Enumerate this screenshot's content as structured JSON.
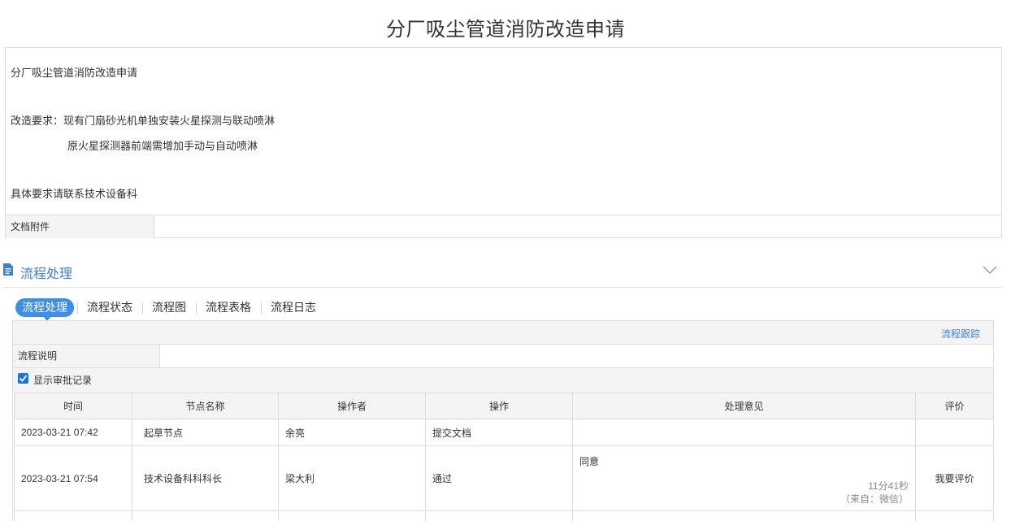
{
  "page": {
    "title": "分厂吸尘管道消防改造申请"
  },
  "document": {
    "lines": [
      "分厂吸尘管道消防改造申请",
      "改造要求：现有门扇砂光机单独安装火星探测与联动喷淋",
      "原火星探测器前端需增加手动与自动喷淋",
      "具体要求请联系技术设备科"
    ],
    "attachment_label": "文档附件"
  },
  "section": {
    "title": "流程处理",
    "icons": [
      "document-icon",
      "chevron-down-icon"
    ]
  },
  "tabs": [
    "流程处理",
    "流程状态",
    "流程图",
    "流程表格",
    "流程日志"
  ],
  "panel": {
    "trace_link": "流程跟踪",
    "desc_label": "流程说明",
    "desc_value": "",
    "show_records_label": "显示审批记录",
    "show_records_checked": true
  },
  "records": {
    "headers": [
      "时间",
      "节点名称",
      "操作者",
      "操作",
      "处理意见",
      "评价"
    ],
    "rows": [
      {
        "time": "2023-03-21 07:42",
        "node": "起草节点",
        "operator": "余亮",
        "action": "提交文档",
        "opinion": "",
        "duration": "",
        "source": "",
        "rating": ""
      },
      {
        "time": "2023-03-21 07:54",
        "node": "技术设备科科科长",
        "operator": "梁大利",
        "action": "通过",
        "opinion": "同意",
        "duration": "11分41秒",
        "source": "（来自：微信）",
        "rating": "我要评价"
      }
    ]
  },
  "colors": {
    "accent": "#3d8ee8",
    "link": "#3d7fd6",
    "border": "#dcdcdc",
    "header_bg": "#f4f4f4"
  }
}
